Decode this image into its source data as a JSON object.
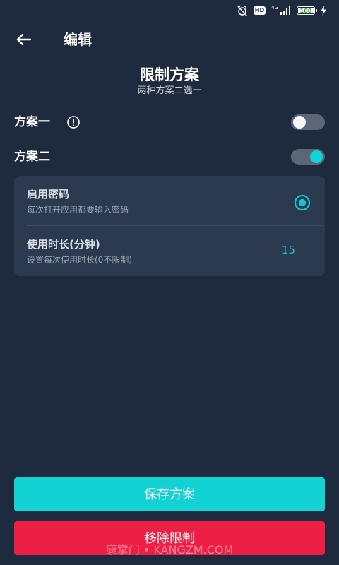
{
  "status_bar": {
    "hd_label": "HD",
    "network_label": "4G",
    "battery_level": "100",
    "battery_fraction": 1.0
  },
  "app_bar": {
    "title": "编辑",
    "back_icon": "arrow-left-icon"
  },
  "plan": {
    "title": "限制方案",
    "subtitle": "两种方案二选一"
  },
  "plans": [
    {
      "label": "方案一",
      "enabled": false,
      "has_info_icon": true
    },
    {
      "label": "方案二",
      "enabled": true,
      "has_info_icon": false
    }
  ],
  "settings": [
    {
      "label": "启用密码",
      "description": "每次打开应用都要输入密码",
      "selected": true
    },
    {
      "label": "使用时长(分钟)",
      "description": "设置每次使用时长(0不限制)",
      "value": "15"
    }
  ],
  "buttons": {
    "save_label": "保存方案",
    "remove_label": "移除限制"
  },
  "watermark": "康掌门 • KANGZM.COM",
  "colors": {
    "background": "#1e2a3d",
    "card": "#2b3a4e",
    "accent": "#12d2d4",
    "danger": "#ee1f45",
    "toggle_off_track": "#5b6677"
  }
}
